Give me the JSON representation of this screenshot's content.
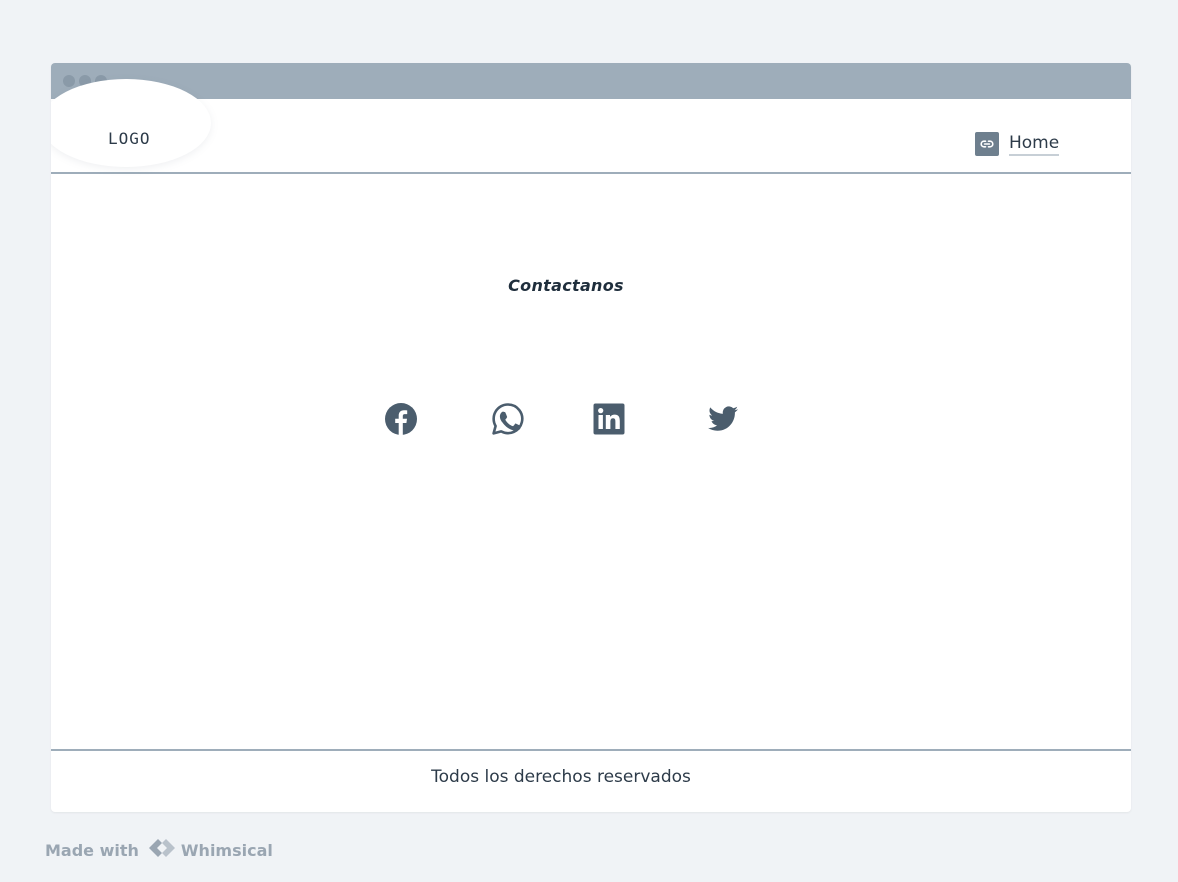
{
  "window": {
    "titlebar_dots": 3
  },
  "header": {
    "logo": "LOGO",
    "nav": {
      "icon": "link-icon",
      "label": "Home"
    }
  },
  "main": {
    "title": "Contactanos",
    "social_icons": [
      "facebook-icon",
      "whatsapp-icon",
      "linkedin-icon",
      "twitter-icon"
    ]
  },
  "footer": {
    "text": "Todos los derechos reservados"
  },
  "watermark": {
    "made_with": "Made with",
    "brand": "Whimsical"
  },
  "colors": {
    "background": "#f0f3f6",
    "titlebar": "#9eadba",
    "icon": "#4b5d6d",
    "text": "#2d3b49"
  }
}
